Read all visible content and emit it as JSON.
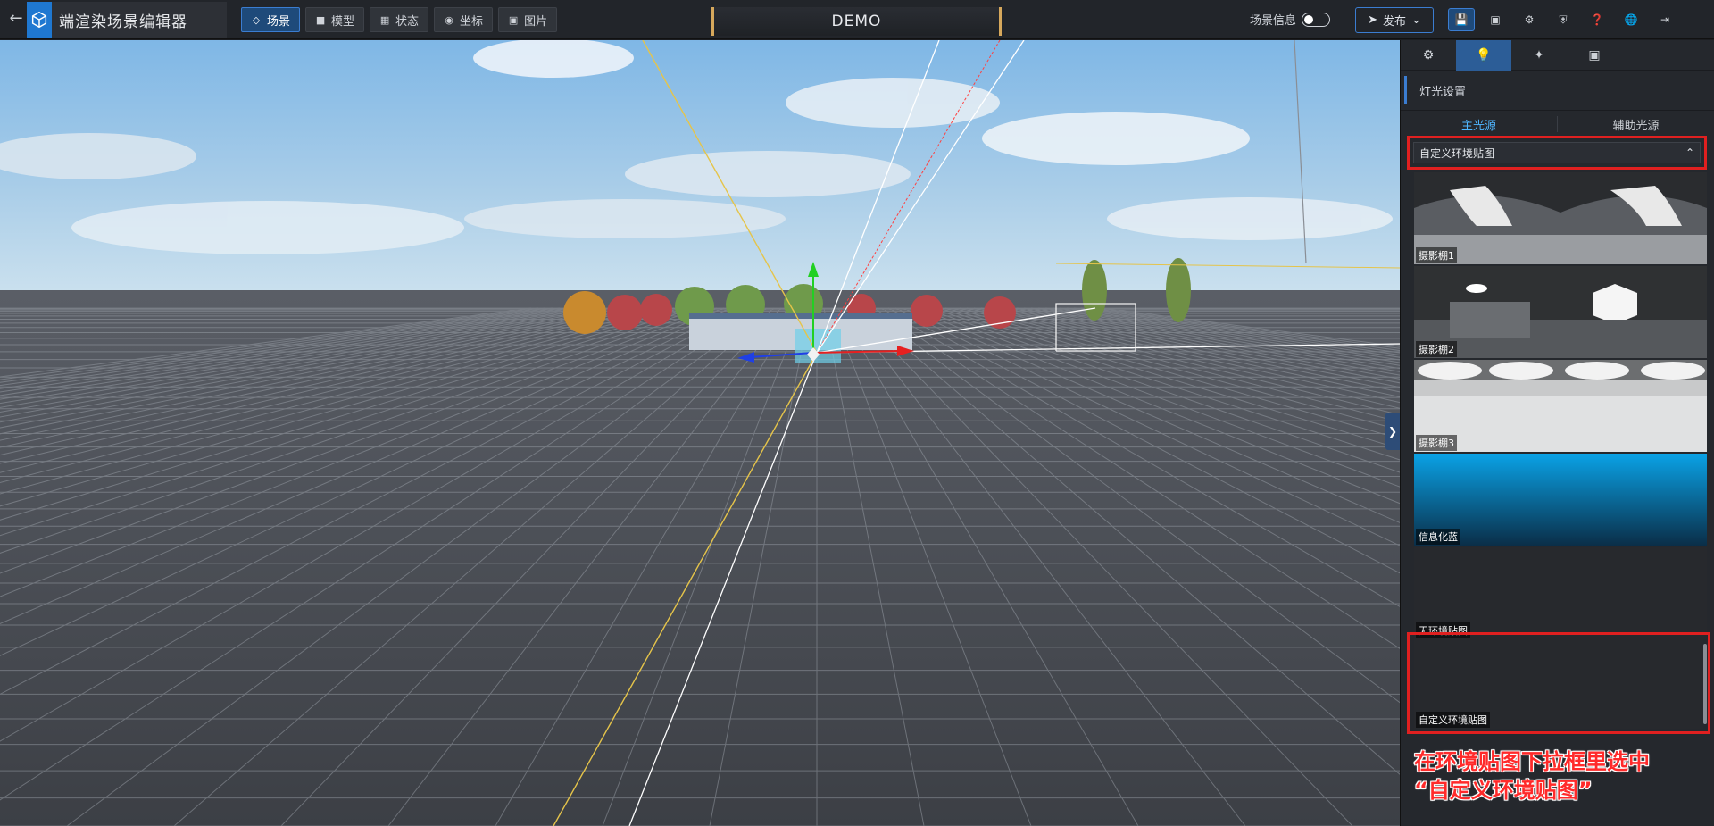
{
  "app": {
    "title": "端渲染场景编辑器",
    "back_icon": "back-arrow-icon",
    "logo_icon": "cube-logo-icon"
  },
  "nav": {
    "tabs": [
      {
        "label": "场景",
        "icon": "layers-icon",
        "active": true
      },
      {
        "label": "模型",
        "icon": "cube-icon",
        "active": false
      },
      {
        "label": "状态",
        "icon": "grid-icon",
        "active": false
      },
      {
        "label": "坐标",
        "icon": "pin-icon",
        "active": false
      },
      {
        "label": "图片",
        "icon": "image-icon",
        "active": false
      }
    ]
  },
  "scene_name": "DEMO",
  "scene_info": {
    "label": "场景信息",
    "toggle_on": false
  },
  "publish": {
    "label": "发布",
    "icon": "send-icon"
  },
  "toolbar_icons": [
    "save-icon",
    "screen-icon",
    "settings-icon",
    "shield-icon",
    "help-icon",
    "globe-icon",
    "exit-icon"
  ],
  "panel": {
    "tabs": [
      "light-bulb-icon",
      "magic-wand-icon",
      "environment-icon",
      "image-icon"
    ],
    "section_title": "灯光设置",
    "sub_tabs": [
      "主光源",
      "辅助光源"
    ],
    "dropdown": {
      "value": "自定义环境贴图"
    },
    "env_maps": [
      {
        "label": "摄影棚1"
      },
      {
        "label": "摄影棚2"
      },
      {
        "label": "摄影棚3"
      },
      {
        "label": "信息化蓝"
      },
      {
        "label": "无环境贴图"
      },
      {
        "label": "自定义环境贴图"
      }
    ]
  },
  "annotation": {
    "line1": "在环境贴图下拉框里选中",
    "line2": "“自定义环境贴图”"
  },
  "colors": {
    "accent": "#3b7dd1",
    "highlight": "#e02020",
    "active_text": "#4fb6ff"
  }
}
